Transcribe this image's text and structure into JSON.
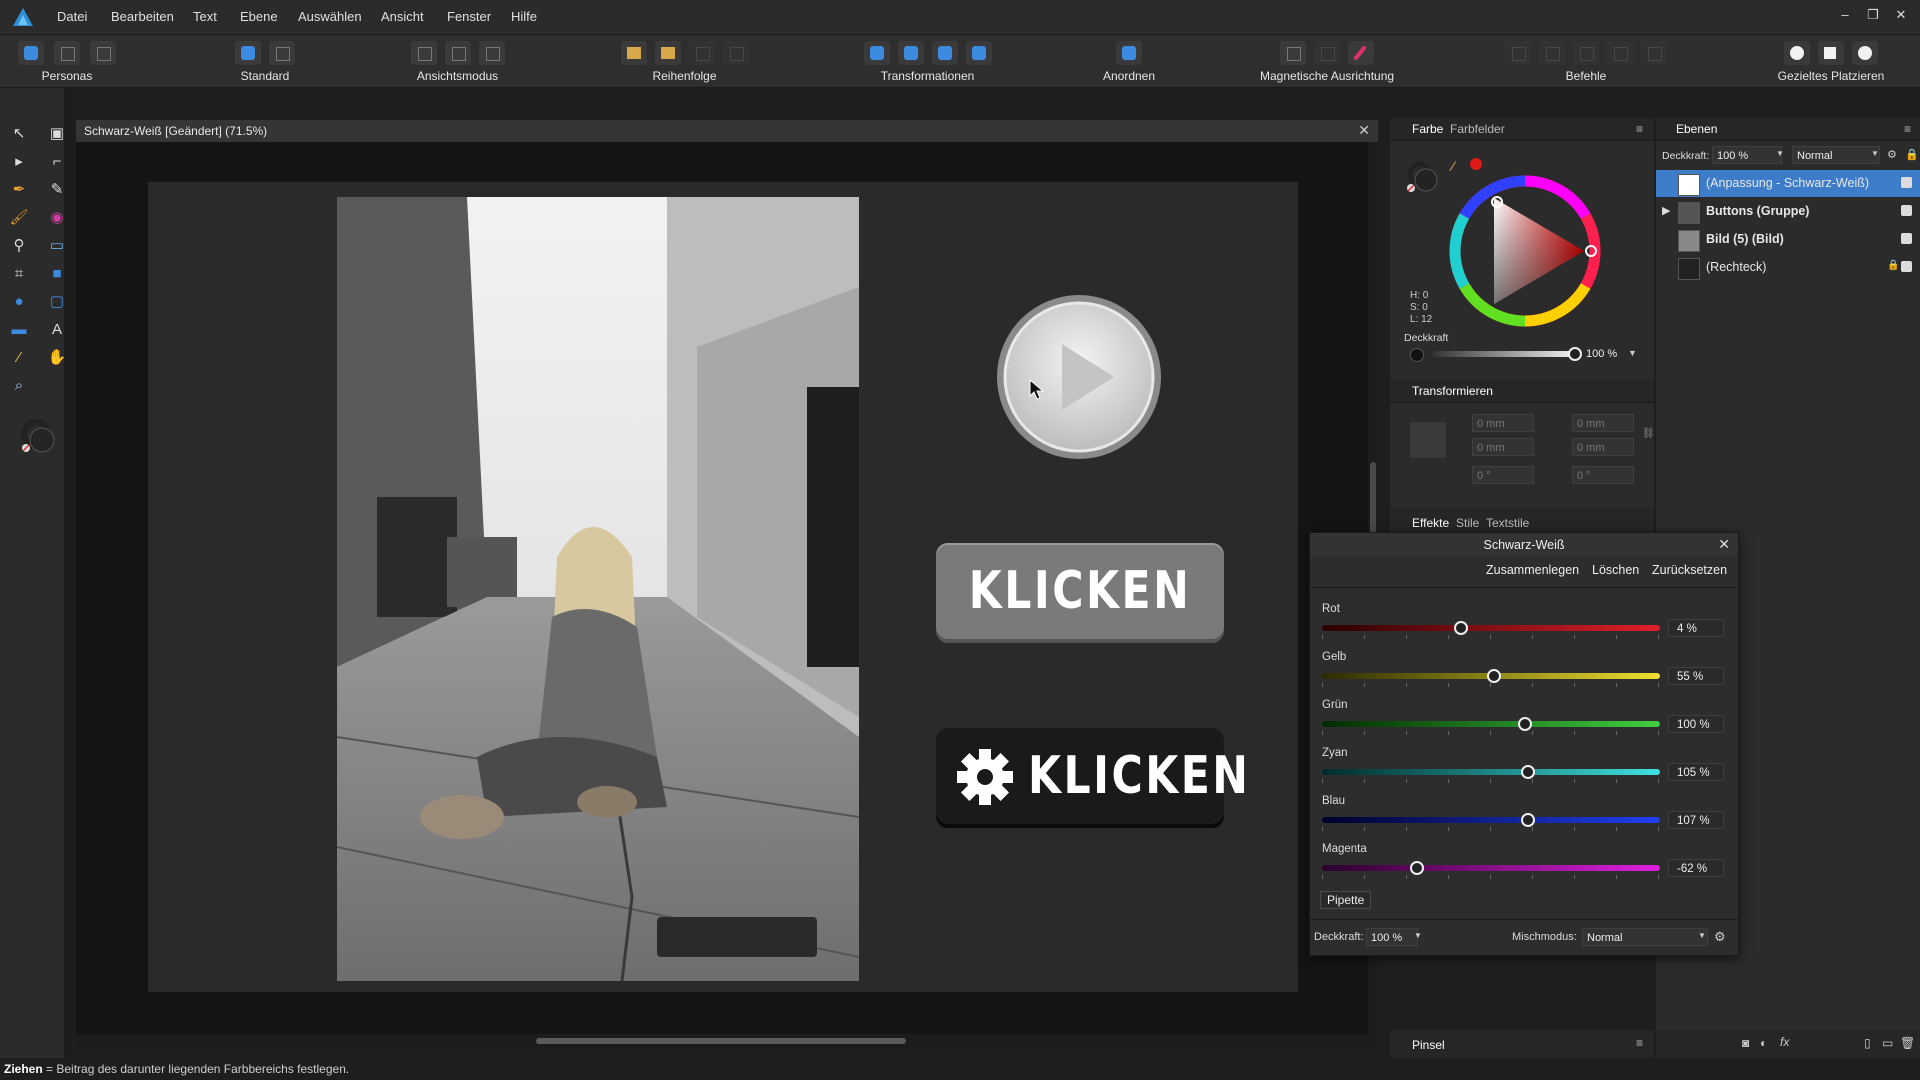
{
  "menubar": {
    "items": [
      "Datei",
      "Bearbeiten",
      "Text",
      "Ebene",
      "Auswählen",
      "Ansicht",
      "Fenster",
      "Hilfe"
    ],
    "window_controls": [
      "–",
      "❐",
      "✕"
    ]
  },
  "toolbar": {
    "groups": [
      {
        "label": "Personas"
      },
      {
        "label": "Standard"
      },
      {
        "label": "Ansichtsmodus"
      },
      {
        "label": "Reihenfolge"
      },
      {
        "label": "Transformationen"
      },
      {
        "label": "Anordnen"
      },
      {
        "label": "Magnetische Ausrichtung"
      },
      {
        "label": "Befehle"
      },
      {
        "label": "Gezieltes Platzieren"
      }
    ]
  },
  "document": {
    "tab_title": "Schwarz-Weiß [Geändert] (71.5%)",
    "close": "✕",
    "button1_text": "KLICKEN",
    "button2_text": "KLICKEN"
  },
  "color_panel": {
    "tabs": [
      "Farbe",
      "Farbfelder"
    ],
    "hsl": {
      "h": "H: 0",
      "s": "S: 0",
      "l": "L: 12"
    },
    "opacity_label": "Deckkraft",
    "opacity_value": "100 %"
  },
  "transform_panel": {
    "title": "Transformieren",
    "x": "0 mm",
    "y": "0 mm",
    "w": "0 mm",
    "h": "0 mm",
    "r": "0 °",
    "s": "0 °"
  },
  "effects_panel": {
    "tabs": [
      "Effekte",
      "Stile",
      "Textstile"
    ]
  },
  "brush_panel": {
    "title": "Pinsel"
  },
  "layers_panel": {
    "title": "Ebenen",
    "opacity_label": "Deckkraft:",
    "opacity_value": "100 %",
    "blend_mode": "Normal",
    "layers": [
      {
        "name": "(Anpassung - Schwarz-Weiß)",
        "selected": true
      },
      {
        "name": "Buttons (Gruppe)",
        "selected": false
      },
      {
        "name": "Bild (5) (Bild)",
        "selected": false
      },
      {
        "name": "(Rechteck)",
        "selected": false
      }
    ]
  },
  "bw_dialog": {
    "title": "Schwarz-Weiß",
    "buttons": {
      "merge": "Zusammenlegen",
      "delete": "Löschen",
      "reset": "Zurücksetzen"
    },
    "sliders": [
      {
        "label": "Rot",
        "value": "4 %",
        "pos": 0.41,
        "from": "#2a0000",
        "to": "#e0202a"
      },
      {
        "label": "Gelb",
        "value": "55 %",
        "pos": 0.51,
        "from": "#2a2a00",
        "to": "#f0e030"
      },
      {
        "label": "Grün",
        "value": "100 %",
        "pos": 0.6,
        "from": "#002a00",
        "to": "#40d040"
      },
      {
        "label": "Zyan",
        "value": "105 %",
        "pos": 0.61,
        "from": "#002a2a",
        "to": "#40e0e0"
      },
      {
        "label": "Blau",
        "value": "107 %",
        "pos": 0.61,
        "from": "#00002a",
        "to": "#2040f0"
      },
      {
        "label": "Magenta",
        "value": "-62 %",
        "pos": 0.28,
        "from": "#2a002a",
        "to": "#e020e0"
      }
    ],
    "pipette": "Pipette",
    "opacity_label": "Deckkraft:",
    "opacity_value": "100 %",
    "blend_label": "Mischmodus:",
    "blend_value": "Normal"
  },
  "status": {
    "bold": "Ziehen",
    "text": " = Beitrag des darunter liegenden Farbbereichs festlegen."
  },
  "colors": {
    "accent": "#3d7cc9",
    "panel": "#2b2b2b",
    "canvas": "#141414"
  }
}
